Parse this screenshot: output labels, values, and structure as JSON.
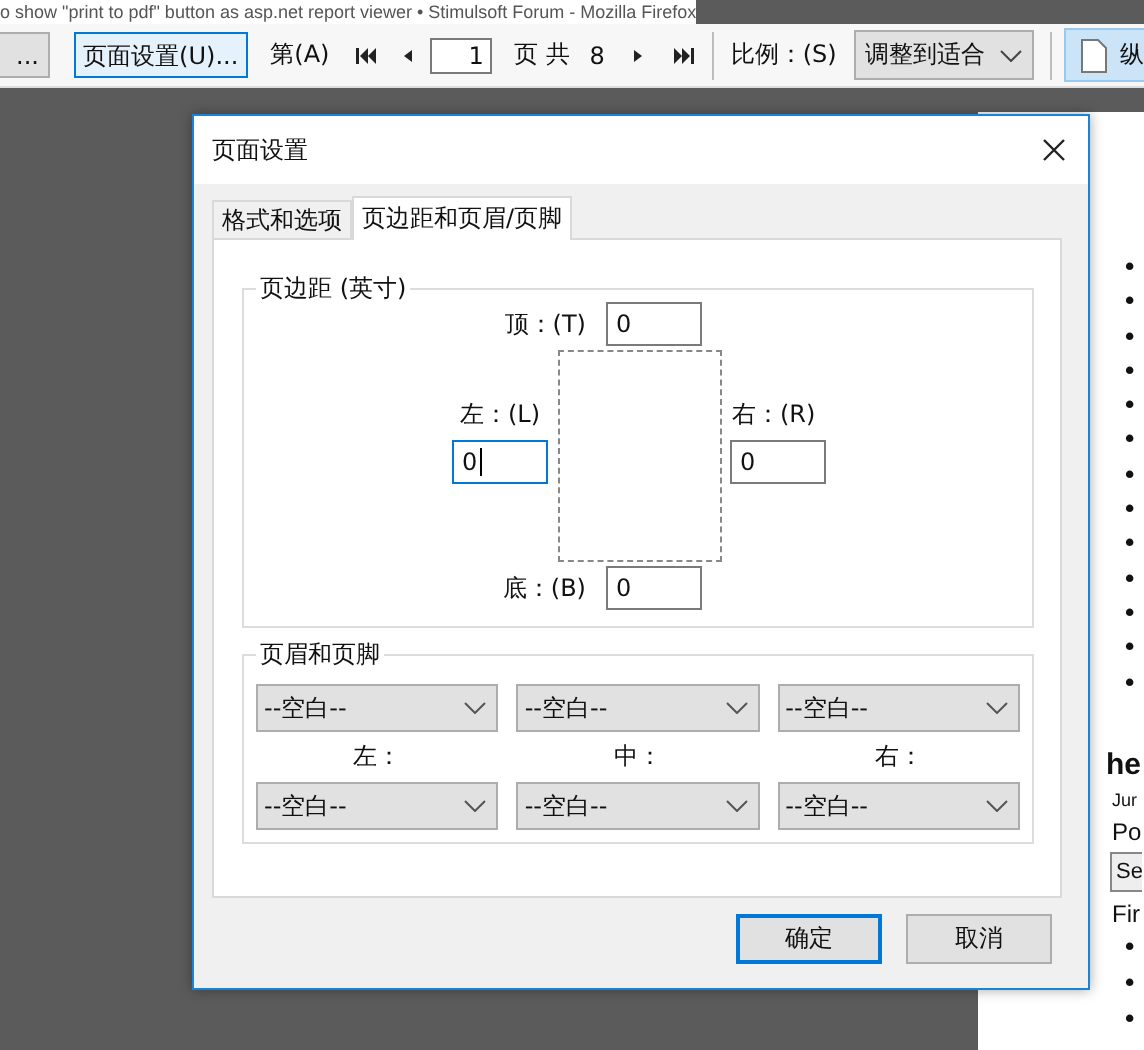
{
  "browser_title": "o show \"print to pdf\" button as asp.net report viewer • Stimulsoft Forum - Mozilla Firefox",
  "toolbar": {
    "cut_button": "...",
    "page_setup_button": {
      "label": "页面设置(U)...",
      "selected": true
    },
    "page_label": "第(A)",
    "page_input": "1",
    "page_of": "页 共",
    "page_total": "8",
    "zoom_label": "比例：(S)",
    "zoom_select": "调整到适合",
    "orientation_button": {
      "label": "纵",
      "selected": true
    }
  },
  "page": {
    "list_1": [
      {
        "marker": "•"
      },
      {
        "marker": "•"
      },
      {
        "marker": "•"
      },
      {
        "marker": "•"
      },
      {
        "marker": "•"
      },
      {
        "marker": "•"
      },
      {
        "marker": "•"
      },
      {
        "marker": "•"
      },
      {
        "marker": "•"
      },
      {
        "marker": "•"
      },
      {
        "marker": "•"
      },
      {
        "marker": "•"
      },
      {
        "marker": "•"
      }
    ],
    "heading": "he",
    "line_1": "Jur",
    "line_2": "Po",
    "select": "Se",
    "line_3": "Fir",
    "list_2": [
      {
        "marker": "•"
      },
      {
        "marker": "•"
      },
      {
        "marker": "•"
      }
    ]
  },
  "dialog": {
    "title": "页面设置",
    "tabs": [
      {
        "label": "格式和选项",
        "selected": false
      },
      {
        "label": "页边距和页眉/页脚",
        "selected": true
      }
    ],
    "margins": {
      "title": "页边距 (英寸)",
      "top": {
        "label": "顶：(T)",
        "value": "0",
        "focused": false
      },
      "left": {
        "label": "左：(L)",
        "value": "0",
        "focused": true
      },
      "right": {
        "label": "右：(R)",
        "value": "0",
        "focused": false
      },
      "bottom": {
        "label": "底：(B)",
        "value": "0",
        "focused": false
      }
    },
    "header_footer": {
      "title": "页眉和页脚",
      "headers": [
        "--空白--",
        "--空白--",
        "--空白--"
      ],
      "labels": [
        "左：",
        "中：",
        "右："
      ],
      "footers": [
        "--空白--",
        "--空白--",
        "--空白--"
      ]
    },
    "buttons": [
      {
        "label": "确定",
        "default": true
      },
      {
        "label": "取消",
        "default": false
      }
    ]
  }
}
